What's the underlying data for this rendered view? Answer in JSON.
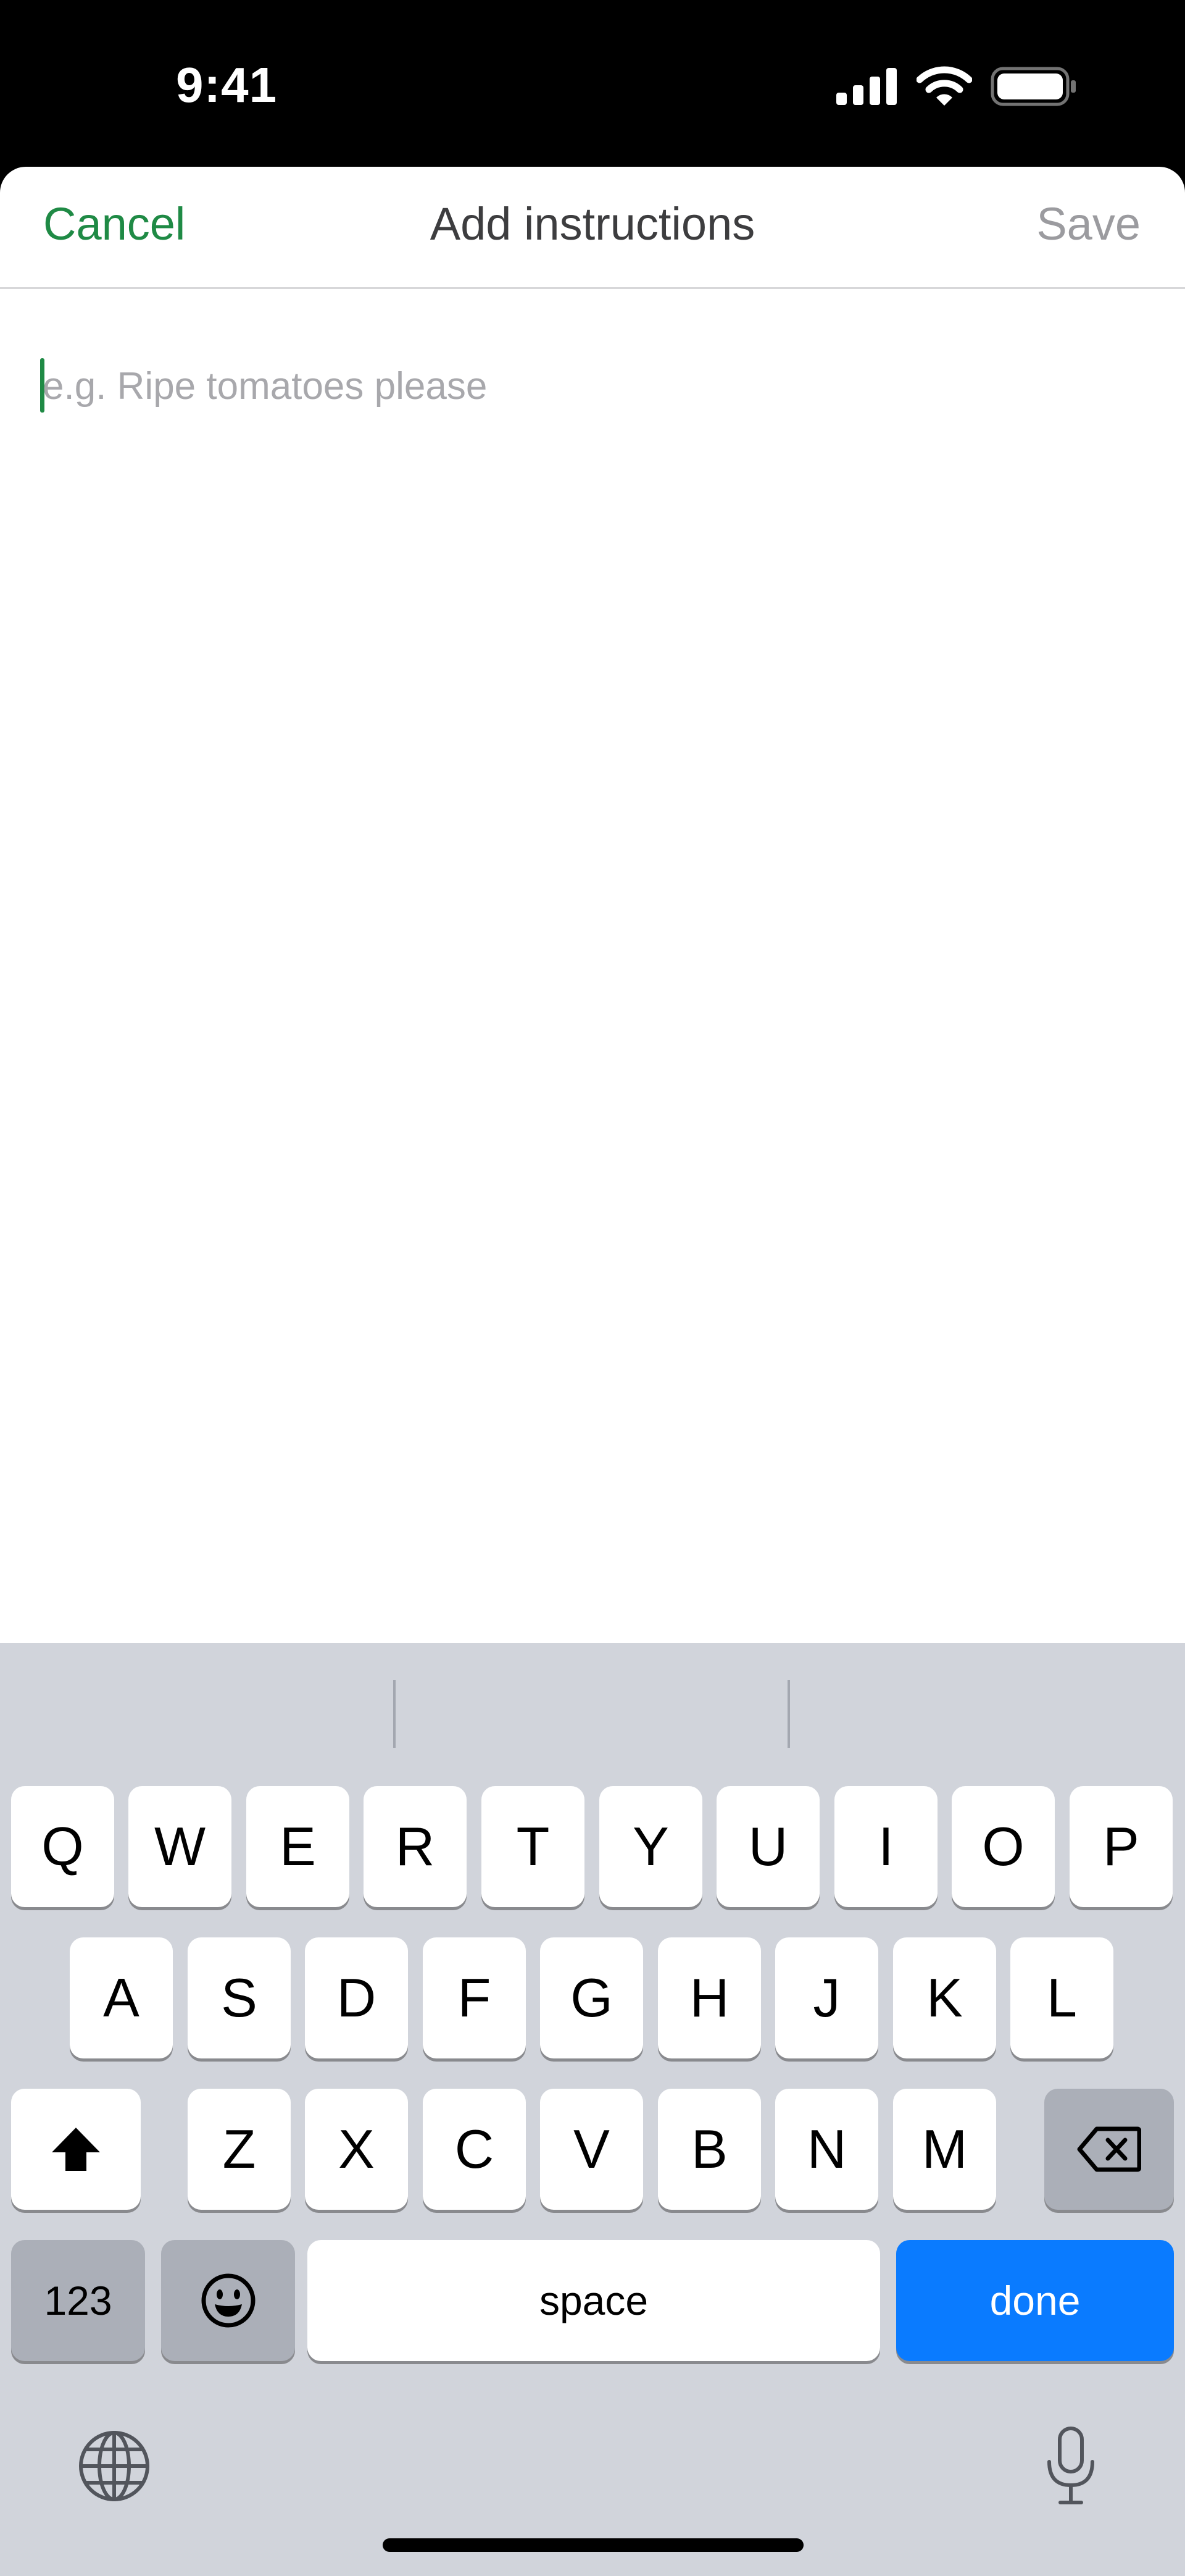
{
  "status_bar": {
    "time": "9:41"
  },
  "nav": {
    "cancel": "Cancel",
    "title": "Add instructions",
    "save": "Save"
  },
  "input": {
    "placeholder": "e.g. Ripe tomatoes please",
    "value": ""
  },
  "keyboard": {
    "row1": [
      "Q",
      "W",
      "E",
      "R",
      "T",
      "Y",
      "U",
      "I",
      "O",
      "P"
    ],
    "row2": [
      "A",
      "S",
      "D",
      "F",
      "G",
      "H",
      "J",
      "K",
      "L"
    ],
    "row3": [
      "Z",
      "X",
      "C",
      "V",
      "B",
      "N",
      "M"
    ],
    "numbers_label": "123",
    "space_label": "space",
    "done_label": "done"
  },
  "colors": {
    "accent": "#1f8a45",
    "done_key": "#0a7bff",
    "keyboard_bg": "#d1d4db"
  }
}
